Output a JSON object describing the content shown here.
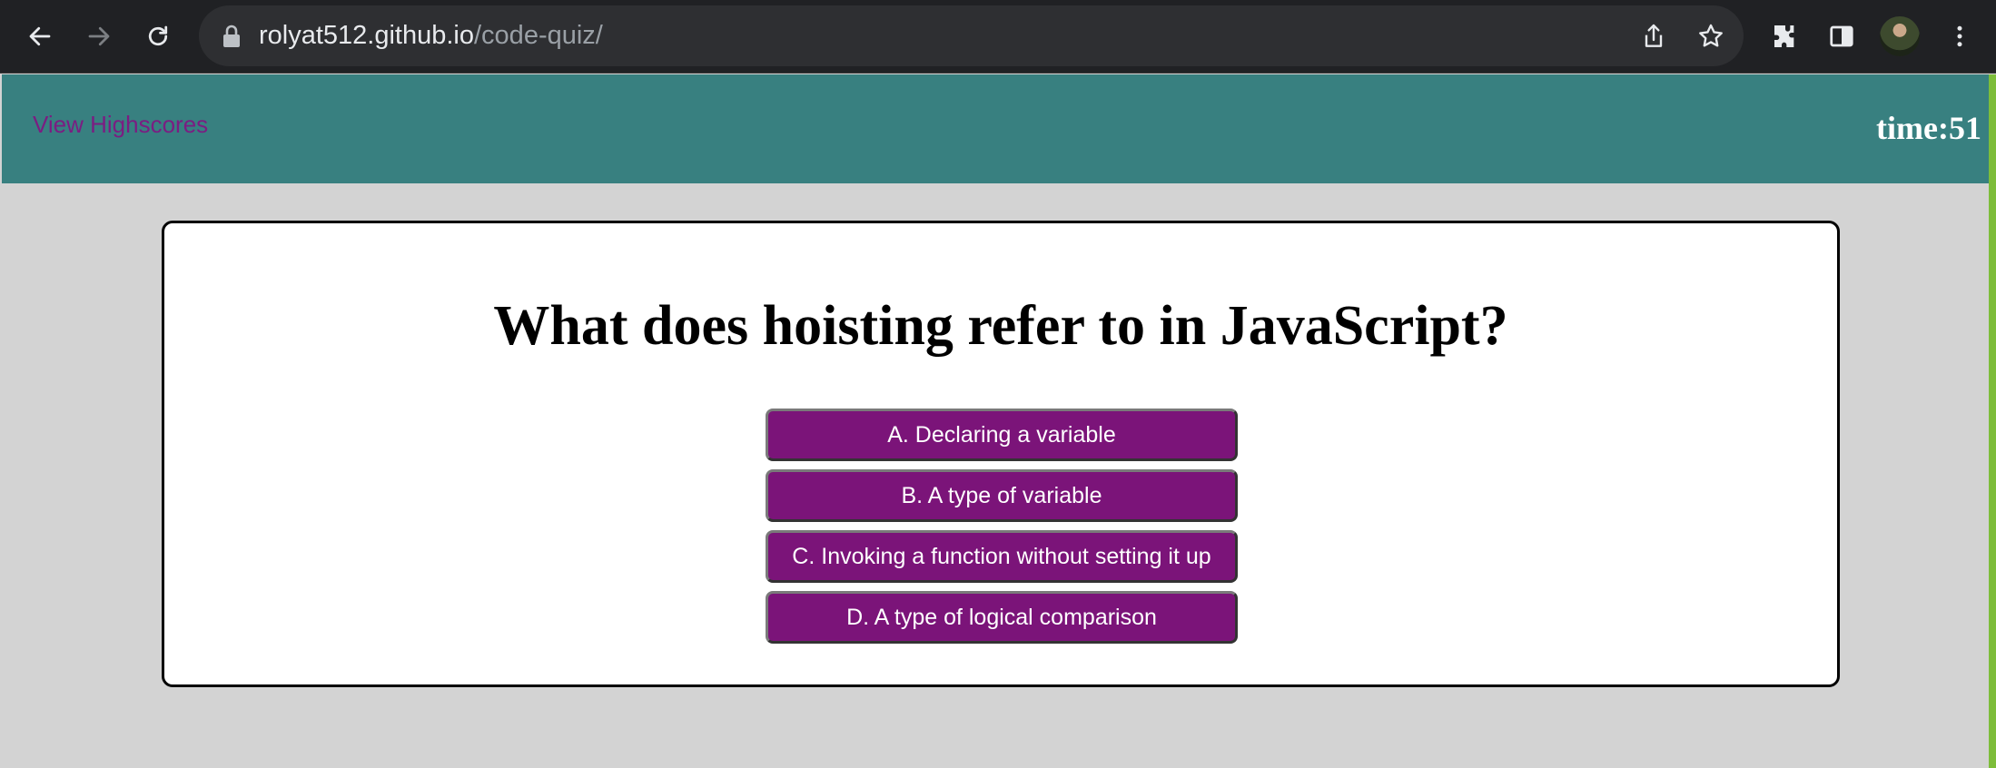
{
  "browser": {
    "url_host": "rolyat512.github.io",
    "url_path": "/code-quiz/",
    "icons": [
      "back-icon",
      "forward-icon",
      "reload-icon",
      "lock-icon",
      "share-icon",
      "star-icon",
      "extensions-icon",
      "side-panel-icon",
      "profile-avatar",
      "menu-icon"
    ]
  },
  "header": {
    "highscores_label": "View Highscores",
    "timer_text": "time:51"
  },
  "quiz": {
    "question": "What does hoisting refer to in JavaScript?",
    "answers": [
      "A. Declaring a variable",
      "B. A type of variable",
      "C. Invoking a function without setting it up",
      "D. A type of logical comparison"
    ]
  },
  "colors": {
    "header_bg": "#388080",
    "page_bg": "#d3d3d3",
    "link": "#7b1d82",
    "answer_bg": "#7b1479"
  }
}
